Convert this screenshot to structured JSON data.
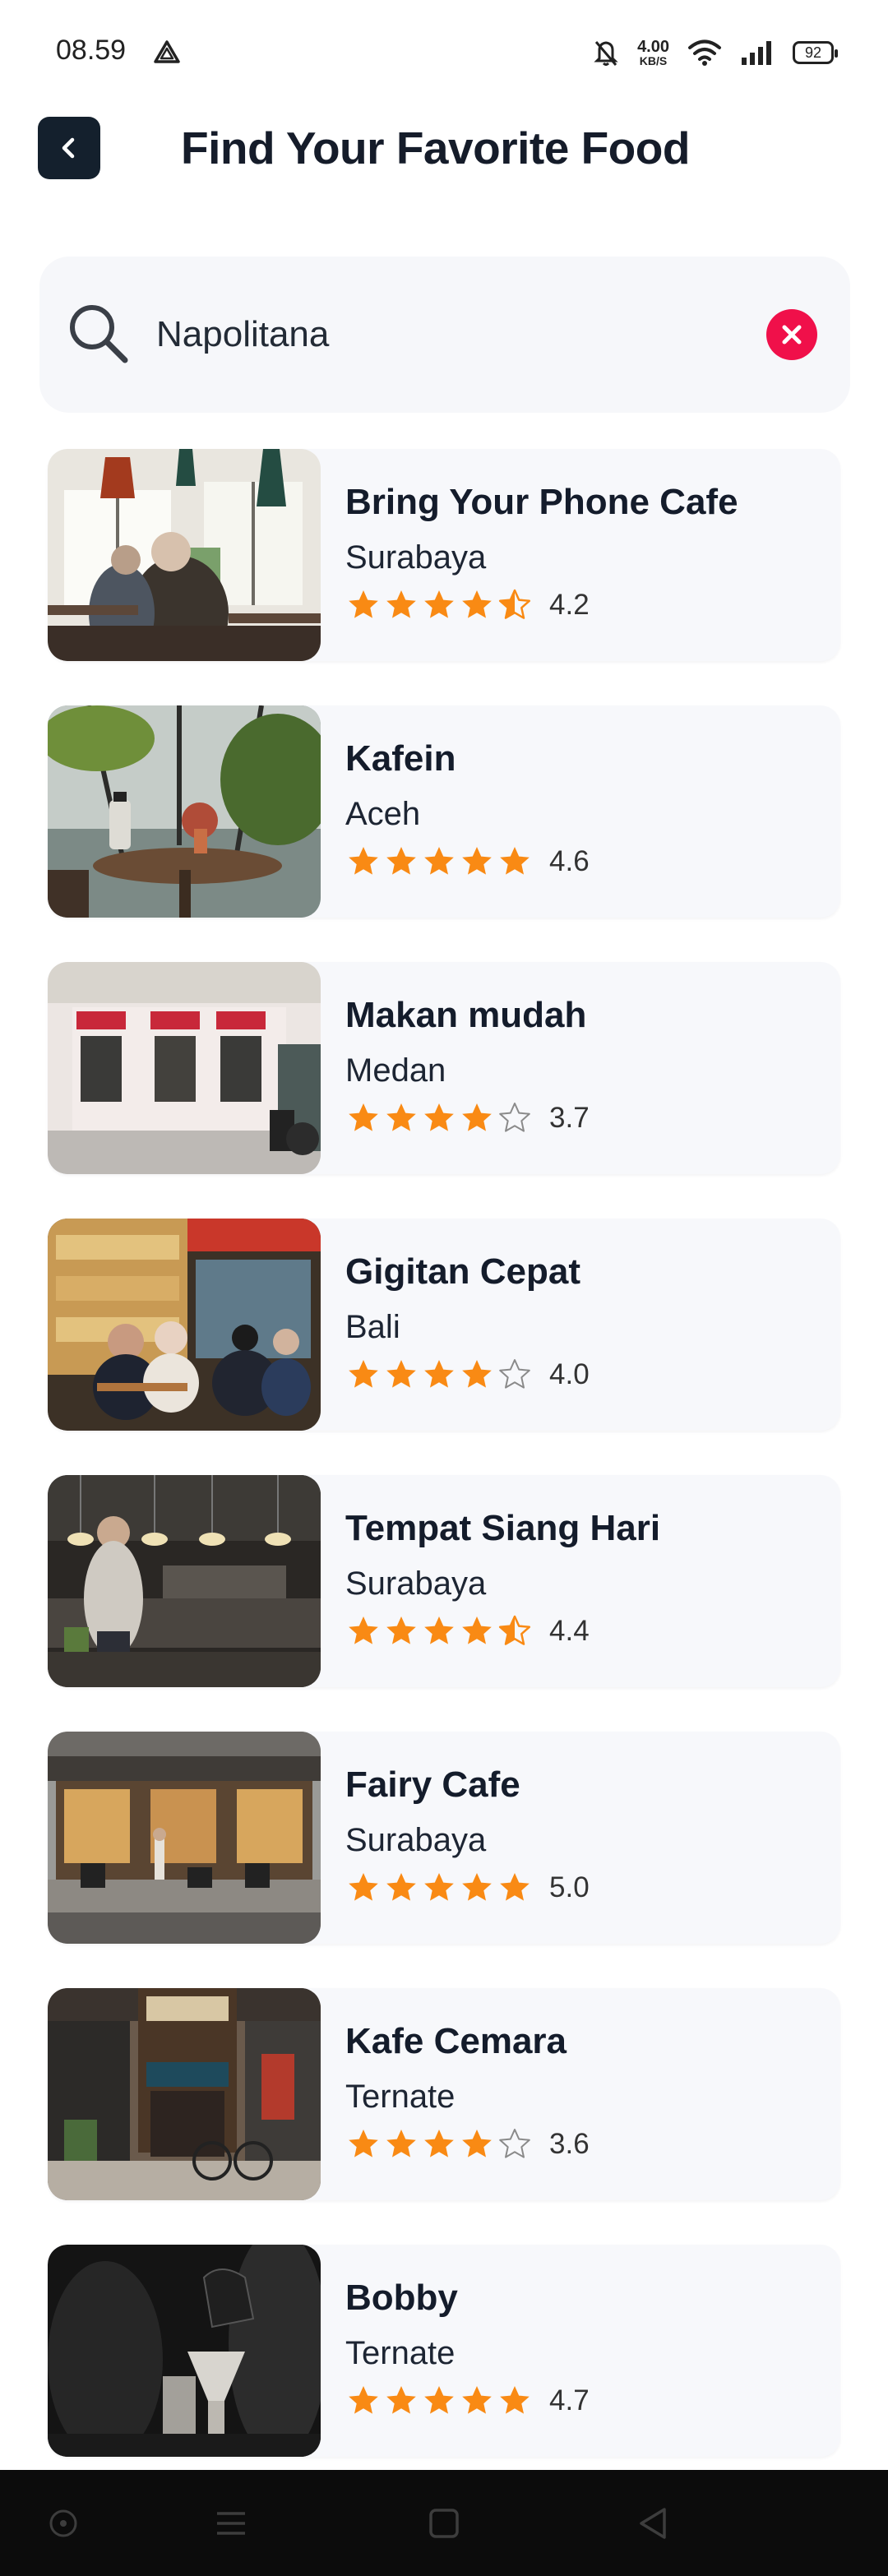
{
  "status_bar": {
    "time": "08.59",
    "speed_value": "4.00",
    "speed_unit": "KB/S",
    "battery": "92"
  },
  "header": {
    "title": "Find Your Favorite Food"
  },
  "search": {
    "value": "Napolitana",
    "placeholder": "Search"
  },
  "colors": {
    "star": "#f98a14",
    "clear_button": "#f0104a",
    "back_button": "#14202d"
  },
  "results": [
    {
      "name": "Bring Your Phone Cafe",
      "city": "Surabaya",
      "rating": 4.2,
      "rating_text": "4.2",
      "stars": [
        1,
        1,
        1,
        1,
        0.5
      ]
    },
    {
      "name": "Kafein",
      "city": "Aceh",
      "rating": 4.6,
      "rating_text": "4.6",
      "stars": [
        1,
        1,
        1,
        1,
        1
      ]
    },
    {
      "name": "Makan mudah",
      "city": "Medan",
      "rating": 3.7,
      "rating_text": "3.7",
      "stars": [
        1,
        1,
        1,
        1,
        0
      ]
    },
    {
      "name": "Gigitan Cepat",
      "city": "Bali",
      "rating": 4.0,
      "rating_text": "4.0",
      "stars": [
        1,
        1,
        1,
        1,
        0
      ]
    },
    {
      "name": "Tempat Siang Hari",
      "city": "Surabaya",
      "rating": 4.4,
      "rating_text": "4.4",
      "stars": [
        1,
        1,
        1,
        1,
        0.5
      ]
    },
    {
      "name": "Fairy Cafe",
      "city": "Surabaya",
      "rating": 5.0,
      "rating_text": "5.0",
      "stars": [
        1,
        1,
        1,
        1,
        1
      ]
    },
    {
      "name": "Kafe Cemara",
      "city": "Ternate",
      "rating": 3.6,
      "rating_text": "3.6",
      "stars": [
        1,
        1,
        1,
        1,
        0
      ]
    },
    {
      "name": "Bobby",
      "city": "Ternate",
      "rating": 4.7,
      "rating_text": "4.7",
      "stars": [
        1,
        1,
        1,
        1,
        1
      ]
    }
  ],
  "nav_icons": [
    "assistant-icon",
    "menu-icon",
    "home-icon",
    "back-icon"
  ]
}
